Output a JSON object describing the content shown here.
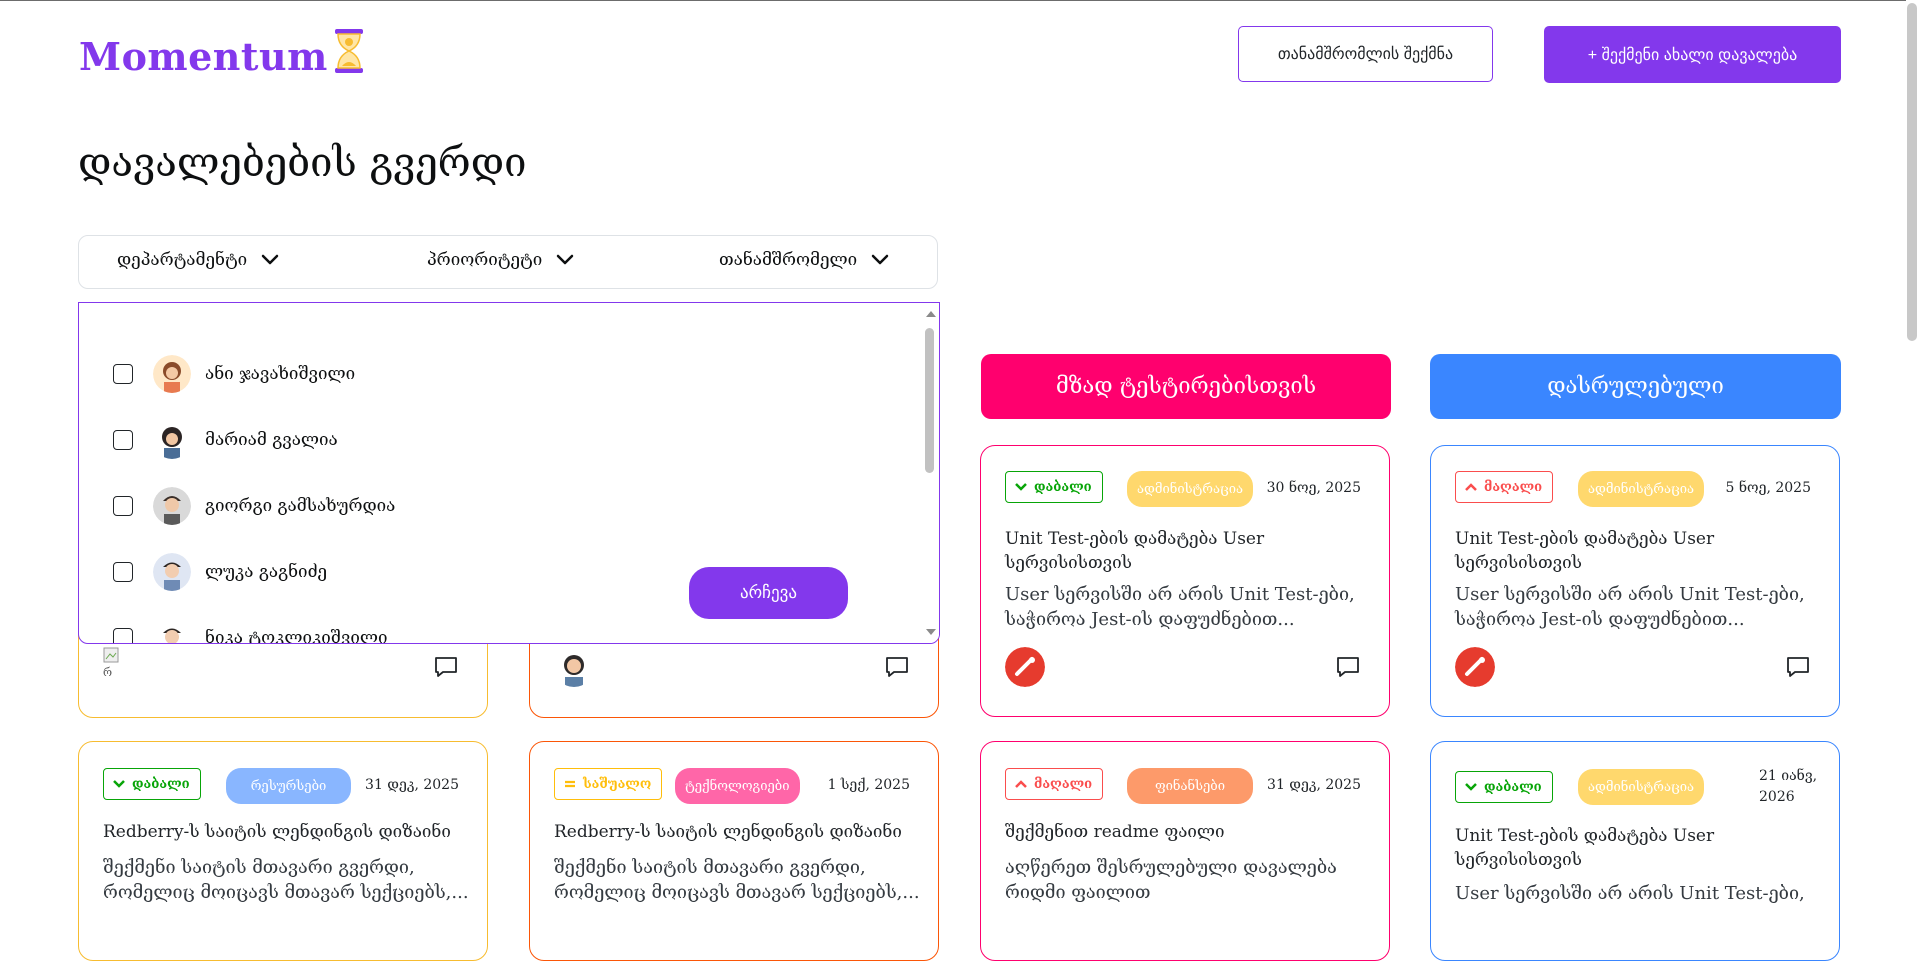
{
  "header": {
    "logo_text": "Momentum",
    "logo_icon": "hourglass-icon",
    "create_employee_label": "თანამშრომლის შექმნა",
    "create_task_label": "+ შექმენი ახალი დავალება"
  },
  "page": {
    "title": "დავალებების გვერდი"
  },
  "filters": {
    "department": "დეპარტამენტი",
    "priority": "პრიორიტეტი",
    "employee": "თანამშრომელი"
  },
  "dropdown": {
    "options": [
      {
        "label": "ანი ჯავახიშვილი",
        "checked": false
      },
      {
        "label": "მარიამ გვალია",
        "checked": false
      },
      {
        "label": "გიორგი გამსახურდია",
        "checked": false
      },
      {
        "label": "ლუკა გაგნიძე",
        "checked": false
      },
      {
        "label": "ნიკა ტოკლიკიშვილი",
        "checked": false
      }
    ],
    "choose_label": "არჩევა"
  },
  "columns": [
    {
      "title": "მზად ტესტირებისთვის",
      "color": "#F7BC30"
    },
    {
      "title": "დასრულებული",
      "color": "#3A86FF"
    }
  ],
  "column_colors": {
    "ready_for_testing": "#FF006E",
    "done": "#3A86FF"
  },
  "cards": {
    "c3": {
      "priority": "დაბალი",
      "department": "ადმინისტრაცია",
      "date": "30 ნოე, 2025",
      "title": "Unit Test-ების დამატება User სერვისისთვის",
      "desc_line1": "User სერვისში არ არის Unit Test-ები,",
      "desc_line2": "საჭიროა Jest-ის დაფუძნებით..."
    },
    "c4": {
      "priority": "მაღალი",
      "department": "ადმინისტრაცია",
      "date": "5 ნოე, 2025",
      "title": "Unit Test-ების დამატება User სერვისისთვის",
      "desc_line1": "User სერვისში არ არის Unit Test-ები,",
      "desc_line2": "საჭიროა Jest-ის დაფუძნებით..."
    },
    "b1": {
      "priority": "დაბალი",
      "department": "რესურსები",
      "date": "31 დეკ, 2025",
      "title": "Redberry-ს საიტის ლენდინგის დიზაინი",
      "desc_line1": "შექმენი საიტის მთავარი გვერდი,",
      "desc_line2": "რომელიც მოიცავს მთავარ სექციებს,..."
    },
    "b2": {
      "priority": "საშუალო",
      "department": "ტექნოლოგიები",
      "date": "1 სექ, 2025",
      "title": "Redberry-ს საიტის ლენდინგის დიზაინი",
      "desc_line1": "შექმენი საიტის მთავარი გვერდი,",
      "desc_line2": "რომელიც მოიცავს მთავარ სექციებს,..."
    },
    "b3": {
      "priority": "მაღალი",
      "department": "ფინანსები",
      "date": "31 დეკ, 2025",
      "title": "შექმენით readme ფაილი",
      "desc_line1": "აღწერეთ შესრულებული დავალება",
      "desc_line2": "რიდმი ფაილით"
    },
    "b4": {
      "priority": "დაბალი",
      "department": "ადმინისტრაცია",
      "date_line1": "21 იანვ,",
      "date_line2": "2026",
      "title": "Unit Test-ების დამატება User სერვისისთვის",
      "desc_line1": "User სერვისში არ არის Unit Test-ები,"
    }
  },
  "broken_image_alt": "რ"
}
